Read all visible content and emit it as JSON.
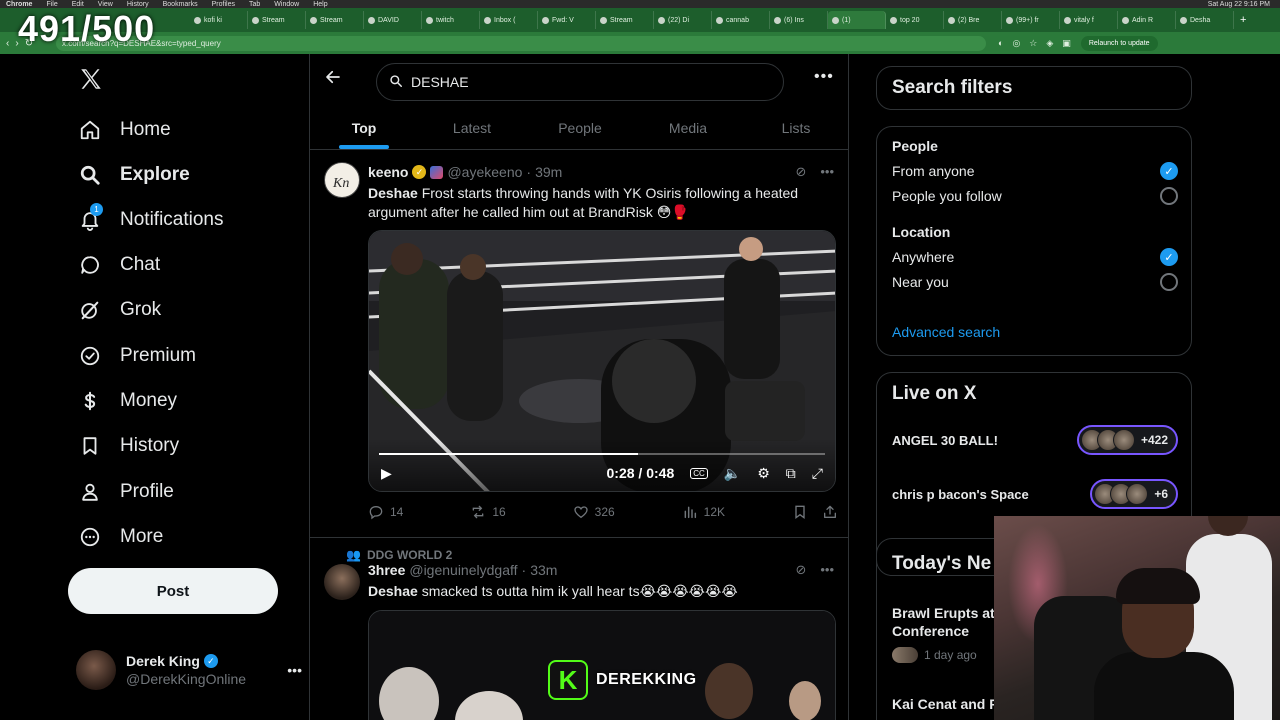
{
  "overlay": {
    "counter": "491/500",
    "streamer_name": "DEREKKING",
    "streamer_logo_letter": "K"
  },
  "browser": {
    "menubar": [
      "Chrome",
      "File",
      "Edit",
      "View",
      "History",
      "Bookmarks",
      "Profiles",
      "Tab",
      "Window",
      "Help"
    ],
    "clock": "Sat Aug 22  9:16 PM",
    "tabs": [
      "kofi ki",
      "Stream",
      "Stream",
      "DAVID",
      "twitch",
      "Inbox (",
      "Fwd: V",
      "Stream",
      "(22) Di",
      "cannab",
      "(6) Ins",
      "(1) ",
      "top 20",
      "(2) Bre",
      "(99+) fr",
      "vitaly f",
      "Adin R",
      "Desha"
    ],
    "address": "x.com/search?q=DESHAE&src=typed_query",
    "relaunch_label": "Relaunch to update"
  },
  "nav": {
    "items": [
      {
        "label": "Home",
        "icon": "home-icon"
      },
      {
        "label": "Explore",
        "icon": "search-icon",
        "active": true
      },
      {
        "label": "Notifications",
        "icon": "bell-icon",
        "badge": "1"
      },
      {
        "label": "Chat",
        "icon": "chat-icon"
      },
      {
        "label": "Grok",
        "icon": "grok-icon"
      },
      {
        "label": "Premium",
        "icon": "premium-icon"
      },
      {
        "label": "Money",
        "icon": "dollar-icon"
      },
      {
        "label": "History",
        "icon": "bookmark-icon"
      },
      {
        "label": "Profile",
        "icon": "person-icon"
      },
      {
        "label": "More",
        "icon": "more-circle-icon"
      }
    ],
    "post_label": "Post",
    "account": {
      "name": "Derek King",
      "handle": "@DerekKingOnline"
    }
  },
  "search": {
    "query": "DESHAE",
    "tabs": [
      "Top",
      "Latest",
      "People",
      "Media",
      "Lists"
    ],
    "active_tab": "Top"
  },
  "tweets": [
    {
      "name": "keeno",
      "handle": "@ayekeeno",
      "time": "39m",
      "text_bold": "Deshae",
      "text_rest": " Frost starts throwing hands with YK Osiris following a heated argument after he called him out at BrandRisk 😳🥊",
      "video_time": "0:28 / 0:48",
      "video_progress": 0.58,
      "replies": "14",
      "reposts": "16",
      "likes": "326",
      "views": "12K"
    },
    {
      "reposted_by": "DDG WORLD 2",
      "name": "3hree",
      "handle": "@igenuinelydgaff",
      "time": "33m",
      "text_bold": "Deshae",
      "text_rest": " smacked ts outta him ik yall hear ts😭😭😭😭😭😭"
    }
  ],
  "filters": {
    "title": "Search filters",
    "people_label": "People",
    "people_options": [
      {
        "label": "From anyone",
        "checked": true
      },
      {
        "label": "People you follow",
        "checked": false
      }
    ],
    "location_label": "Location",
    "location_options": [
      {
        "label": "Anywhere",
        "checked": true
      },
      {
        "label": "Near you",
        "checked": false
      }
    ],
    "advanced_label": "Advanced search"
  },
  "live": {
    "title": "Live on X",
    "spaces": [
      {
        "title": "ANGEL 30 BALL!",
        "count": "+422"
      },
      {
        "title": "chris p bacon's Space",
        "count": "+6"
      }
    ]
  },
  "news": {
    "title": "Today's Ne",
    "items": [
      {
        "title": "Brawl Erupts at\nConference",
        "meta": "1 day ago"
      },
      {
        "title": "Kai Cenat and R"
      }
    ]
  }
}
